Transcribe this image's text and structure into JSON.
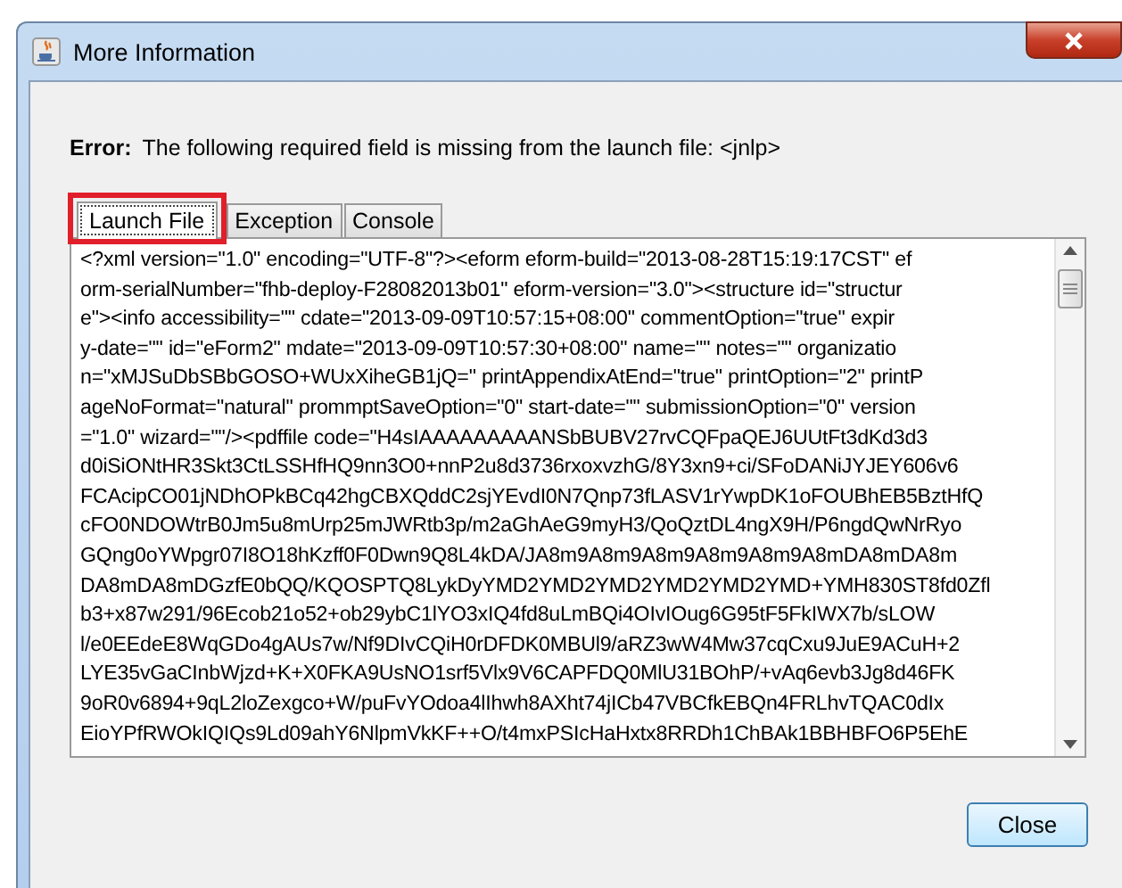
{
  "window": {
    "title": "More Information"
  },
  "error": {
    "label": "Error:",
    "message": "The following required field is missing from the launch file: <jnlp>"
  },
  "tabs": [
    {
      "label": "Launch File",
      "selected": true,
      "highlighted": true
    },
    {
      "label": "Exception",
      "selected": false,
      "highlighted": false
    },
    {
      "label": "Console",
      "selected": false,
      "highlighted": false
    }
  ],
  "launch_file_lines": [
    "<?xml version=\"1.0\" encoding=\"UTF-8\"?><eform eform-build=\"2013-08-28T15:19:17CST\" ef",
    "orm-serialNumber=\"fhb-deploy-F28082013b01\" eform-version=\"3.0\"><structure id=\"structur",
    "e\"><info accessibility=\"\" cdate=\"2013-09-09T10:57:15+08:00\" commentOption=\"true\" expir",
    "y-date=\"\" id=\"eForm2\" mdate=\"2013-09-09T10:57:30+08:00\" name=\"\" notes=\"\" organizatio",
    "n=\"xMJSuDbSBbGOSO+WUxXiheGB1jQ=\" printAppendixAtEnd=\"true\" printOption=\"2\" printP",
    "ageNoFormat=\"natural\" prommptSaveOption=\"0\" start-date=\"\" submissionOption=\"0\" version",
    "=\"1.0\" wizard=\"\"/><pdffile code=\"H4sIAAAAAAAAANSbBUBV27rvCQFpaQEJ6UUtFt3dKd3d3",
    "d0iSiONtHR3Skt3CtLSSHfHQ9nn3O0+nnP2u8d3736rxoxvzhG/8Y3xn9+ci/SFoDANiJYJEY606v6",
    "FCAcipCO01jNDhOPkBCq42hgCBXQddC2sjYEvdI0N7Qnp73fLASV1rYwpDK1oFOUBhEB5BztHfQ",
    "cFO0NDOWtrB0Jm5u8mUrp25mJWRtb3p/m2aGhAeG9myH3/QoQztDL4ngX9H/P6ngdQwNrRyo",
    "GQng0oYWpgr07I8O18hKzff0F0Dwn9Q8L4kDA/JA8m9A8m9A8m9A8m9A8m9A8mDA8mDA8m",
    "DA8mDA8mDGzfE0bQQ/KQOSPTQ8LykDyYMD2YMD2YMD2YMD2YMD2YMD+YMH830ST8fd0Zfl",
    "b3+x87w291/96Ecob21o52+ob29ybC1lYO3xIQ4fd8uLmBQi4OIvIOug6G95tF5FkIWX7b/sLOW",
    "l/e0EEdeE8WqGDo4gAUs7w/Nf9DIvCQiH0rDFDK0MBUl9/aRZ3wW4Mw37cqCxu9JuE9ACuH+2",
    "LYE35vGaCInbWjzd+K+X0FKA9UsNO1srf5Vlx9V6CAPFDQ0MlU31BOhP/+vAq6evb3Jg8d46FK",
    "9oR0v6894+9qL2loZexgco+W/puFvYOdoa4lIhwh8AXht74jICb47VBCfkEBQn4FRLhvTQAC0dIx",
    "EioYPfRWOkIQIQs9Ld09ahY6NlpmVkKF++O/t4mxPSIcHaHxtx8RRDh1ChBAk1BBHBFO6P5EhE"
  ],
  "buttons": [
    "Close"
  ]
}
